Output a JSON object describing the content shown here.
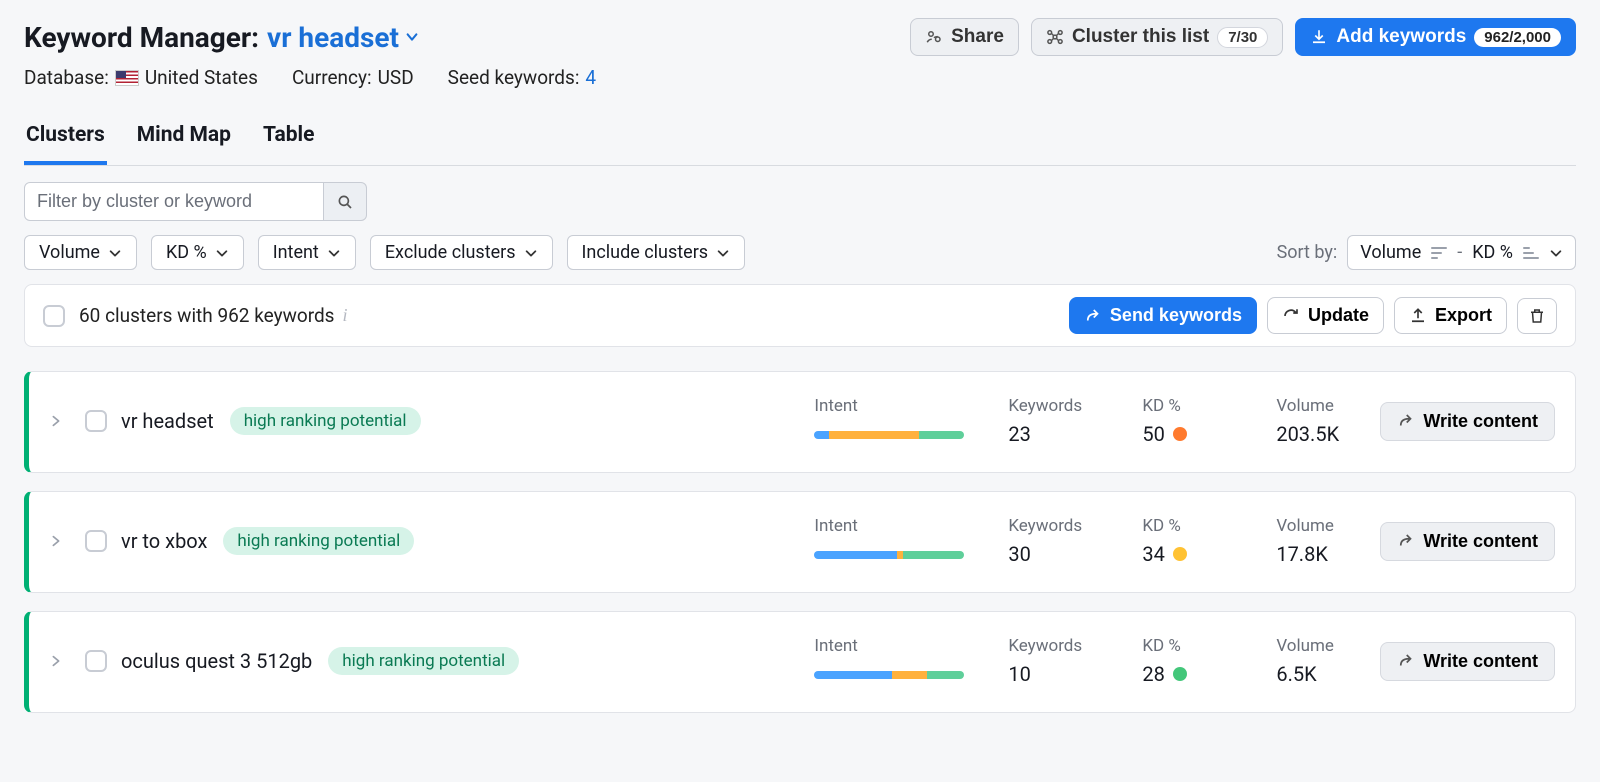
{
  "header": {
    "title_prefix": "Keyword Manager:",
    "title_keyword": "vr headset",
    "share_label": "Share",
    "cluster_label": "Cluster this list",
    "cluster_count": "7/30",
    "add_label": "Add keywords",
    "add_count": "962/2,000"
  },
  "meta": {
    "database_label": "Database:",
    "database_value": "United States",
    "currency_label": "Currency:",
    "currency_value": "USD",
    "seed_label": "Seed keywords:",
    "seed_value": "4"
  },
  "tabs": [
    "Clusters",
    "Mind Map",
    "Table"
  ],
  "active_tab": 0,
  "filters": {
    "search_placeholder": "Filter by cluster or keyword",
    "chips": [
      "Volume",
      "KD %",
      "Intent",
      "Exclude clusters",
      "Include clusters"
    ],
    "sort_label": "Sort by:",
    "sort_primary": "Volume",
    "sort_secondary": "KD %"
  },
  "summary": {
    "text": "60 clusters with 962 keywords",
    "send_label": "Send keywords",
    "update_label": "Update",
    "export_label": "Export"
  },
  "metric_labels": {
    "intent": "Intent",
    "keywords": "Keywords",
    "kd": "KD %",
    "volume": "Volume"
  },
  "write_label": "Write content",
  "badge_label": "high ranking potential",
  "clusters": [
    {
      "name": "vr headset",
      "intent_segments": [
        10,
        60,
        30
      ],
      "keywords": "23",
      "kd": "50",
      "kd_color": "orange",
      "volume": "203.5K"
    },
    {
      "name": "vr to xbox",
      "intent_segments": [
        55,
        4,
        41
      ],
      "keywords": "30",
      "kd": "34",
      "kd_color": "yellow",
      "volume": "17.8K"
    },
    {
      "name": "oculus quest 3 512gb",
      "intent_segments": [
        52,
        23,
        25
      ],
      "keywords": "10",
      "kd": "28",
      "kd_color": "green",
      "volume": "6.5K"
    }
  ]
}
